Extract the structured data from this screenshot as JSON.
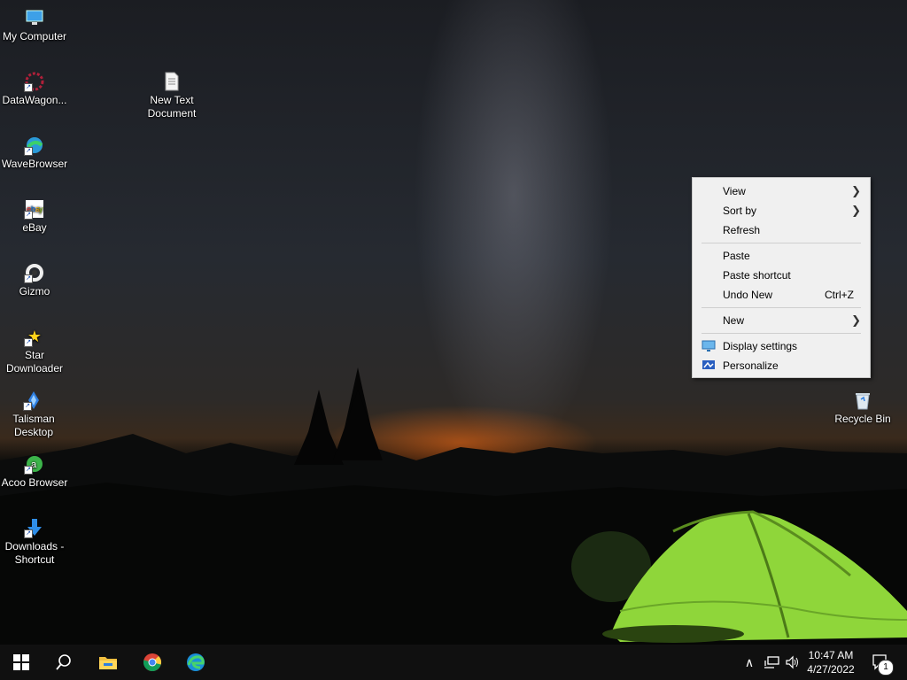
{
  "desktop_icons": [
    {
      "label": "My Computer",
      "icon": "computer-icon"
    },
    {
      "label": "DataWagon...",
      "icon": "datawagon-icon"
    },
    {
      "label": "New Text Document",
      "icon": "text-document-icon"
    },
    {
      "label": "WaveBrowser",
      "icon": "wavebrowser-icon"
    },
    {
      "label": "eBay",
      "icon": "ebay-icon"
    },
    {
      "label": "Gizmo",
      "icon": "gizmo-icon"
    },
    {
      "label": "Star Downloader",
      "icon": "star-downloader-icon"
    },
    {
      "label": "Talisman Desktop",
      "icon": "talisman-icon"
    },
    {
      "label": "Acoo Browser",
      "icon": "acoo-browser-icon"
    },
    {
      "label": "Downloads - Shortcut",
      "icon": "downloads-icon"
    },
    {
      "label": "Recycle Bin",
      "icon": "recycle-bin-icon"
    }
  ],
  "context_menu": {
    "view": "View",
    "sort_by": "Sort by",
    "refresh": "Refresh",
    "paste": "Paste",
    "paste_shortcut": "Paste shortcut",
    "undo_new": "Undo New",
    "undo_new_shortcut": "Ctrl+Z",
    "new": "New",
    "display_settings": "Display settings",
    "personalize": "Personalize"
  },
  "taskbar": {
    "pinned": [
      "start-icon",
      "search-icon",
      "file-explorer-icon",
      "chrome-icon",
      "edge-icon"
    ],
    "time": "10:47 AM",
    "date": "4/27/2022",
    "notification_count": "1"
  },
  "colors": {
    "menu_bg": "#f0f0f0",
    "taskbar_bg": "#101010",
    "tent_green": "#8fd63a"
  }
}
